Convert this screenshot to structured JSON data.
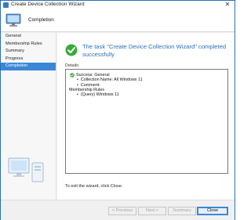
{
  "window": {
    "title": "Create Device Collection Wizard",
    "close_glyph": "✕"
  },
  "header": {
    "title": "Completion",
    "icon": "computer-icon"
  },
  "sidebar": {
    "items": [
      {
        "label": "General"
      },
      {
        "label": "Membership Rules"
      },
      {
        "label": "Summary"
      },
      {
        "label": "Progress"
      },
      {
        "label": "Completion",
        "active": true
      }
    ]
  },
  "main": {
    "status_title": "The task \"Create Device Collection Wizard\" completed successfully",
    "details_label": "Details:",
    "details": {
      "success": "Success: General",
      "collection_name": "Collection Name: All Windows 11",
      "comment": "Comment:",
      "membership_heading": "Membership Rules",
      "rule": "(Query) Windows 11"
    },
    "exit_text": "To exit the wizard, click Close."
  },
  "footer": {
    "previous": "< Previous",
    "next": "Next >",
    "summary": "Summary",
    "close": "Close"
  },
  "colors": {
    "accent": "#3b86d6",
    "title_blue": "#2b6fb6",
    "success_green": "#3aa93a"
  }
}
